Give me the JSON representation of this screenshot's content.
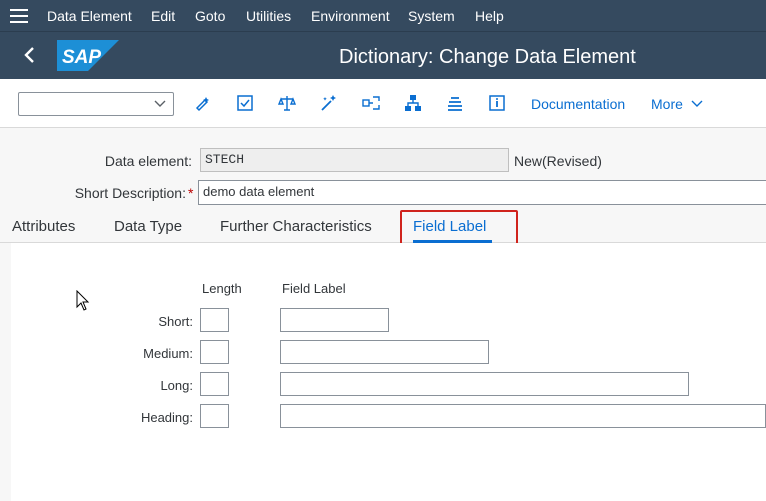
{
  "menubar": {
    "items": [
      "Data Element",
      "Edit",
      "Goto",
      "Utilities",
      "Environment",
      "System",
      "Help"
    ]
  },
  "shell": {
    "logo_text": "SAP",
    "title": "Dictionary: Change Data Element"
  },
  "toolbar": {
    "select_value": "",
    "icons": [
      "display-change-icon",
      "check-icon",
      "activate-icon",
      "magic-wand-icon",
      "where-used-icon",
      "hierarchy-icon",
      "object-list-icon",
      "info-icon"
    ],
    "documentation_label": "Documentation",
    "more_label": "More"
  },
  "header": {
    "data_element_label": "Data element:",
    "data_element_value": "STECH",
    "status": "New(Revised)",
    "short_desc_label": "Short Description:",
    "required_mark": "*",
    "short_desc_value": "demo data element"
  },
  "tabs": [
    {
      "label": "Attributes",
      "active": false
    },
    {
      "label": "Data Type",
      "active": false
    },
    {
      "label": "Further Characteristics",
      "active": false
    },
    {
      "label": "Field Label",
      "active": true
    }
  ],
  "field_label_panel": {
    "col_length": "Length",
    "col_field_label": "Field Label",
    "rows": [
      {
        "label": "Short:",
        "length": "",
        "text": ""
      },
      {
        "label": "Medium:",
        "length": "",
        "text": ""
      },
      {
        "label": "Long:",
        "length": "",
        "text": ""
      },
      {
        "label": "Heading:",
        "length": "",
        "text": ""
      }
    ]
  },
  "colors": {
    "shell_bg": "#354a5f",
    "link": "#0a6ed1",
    "highlight": "#d0231c",
    "sap_logo": "#1d8fd6"
  }
}
